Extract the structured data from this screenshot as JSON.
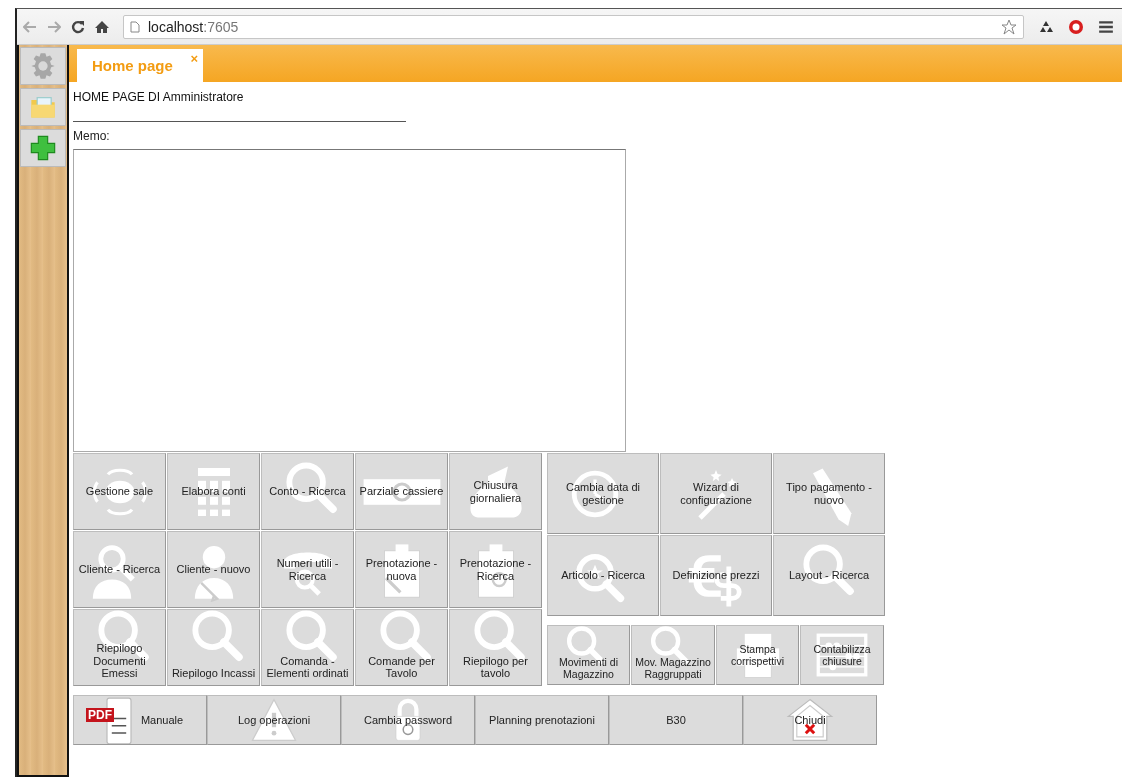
{
  "browser": {
    "url_host": "localhost",
    "url_port": ":7605"
  },
  "sidebar": {
    "items": [
      {
        "kind": "gear"
      },
      {
        "kind": "folder"
      },
      {
        "kind": "plus"
      }
    ]
  },
  "tabs": [
    {
      "label": "Home page",
      "selected": true,
      "close": "×"
    }
  ],
  "page": {
    "heading": "HOME PAGE DI Amministratore",
    "memo_label": "Memo:"
  },
  "grid_left": [
    {
      "label": "Gestione sale",
      "kind": "table"
    },
    {
      "label": "Elabora conti",
      "kind": "calc"
    },
    {
      "label": "Conto - Ricerca",
      "kind": "search"
    },
    {
      "label": "Parziale cassiere",
      "kind": "cash"
    },
    {
      "label": "Chiusura giornaliera",
      "kind": "bag"
    },
    {
      "label": "Cliente - Ricerca",
      "kind": "person-search"
    },
    {
      "label": "Cliente - nuovo",
      "kind": "person-edit"
    },
    {
      "label": "Numeri utili - Ricerca",
      "kind": "phone"
    },
    {
      "label": "Prenotazione - nuova",
      "kind": "clip-edit"
    },
    {
      "label": "Prenotazione - Ricerca",
      "kind": "clip-search"
    },
    {
      "label": "Riepilogo Documenti Emessi",
      "kind": "search"
    },
    {
      "label": "Riepilogo Incassi",
      "kind": "search"
    },
    {
      "label": "Comanda - Elementi ordinati",
      "kind": "search"
    },
    {
      "label": "Comande per Tavolo",
      "kind": "search"
    },
    {
      "label": "Riepilogo per tavolo",
      "kind": "search"
    }
  ],
  "grid_right": [
    {
      "label": "Cambia data di gestione",
      "kind": "clock"
    },
    {
      "label": "Wizard di configurazione",
      "kind": "wand"
    },
    {
      "label": "Tipo pagamento - nuovo",
      "kind": "pencil"
    },
    {
      "label": "Articolo - Ricerca",
      "kind": "star-search"
    },
    {
      "label": "Definizione prezzi",
      "kind": "money"
    },
    {
      "label": "Layout - Ricerca",
      "kind": "search"
    }
  ],
  "grid_right_bottom": [
    {
      "label": "Movimenti di Magazzino",
      "kind": "search"
    },
    {
      "label": "Mov. Magazzino Raggruppati",
      "kind": "search"
    },
    {
      "label": "Stampa corrispettivi",
      "kind": "printer"
    },
    {
      "label": "Contabilizza chiusure",
      "kind": "abacus"
    }
  ],
  "bottom_bar": [
    {
      "label": "Manuale",
      "kind": "pdf",
      "badge": "PDF"
    },
    {
      "label": "Log operazioni",
      "kind": "warning"
    },
    {
      "label": "Cambia password",
      "kind": "lock"
    },
    {
      "label": "Planning prenotazioni",
      "kind": "plain"
    },
    {
      "label": "B30",
      "kind": "plain"
    },
    {
      "label": "Chiudi",
      "kind": "house"
    }
  ]
}
